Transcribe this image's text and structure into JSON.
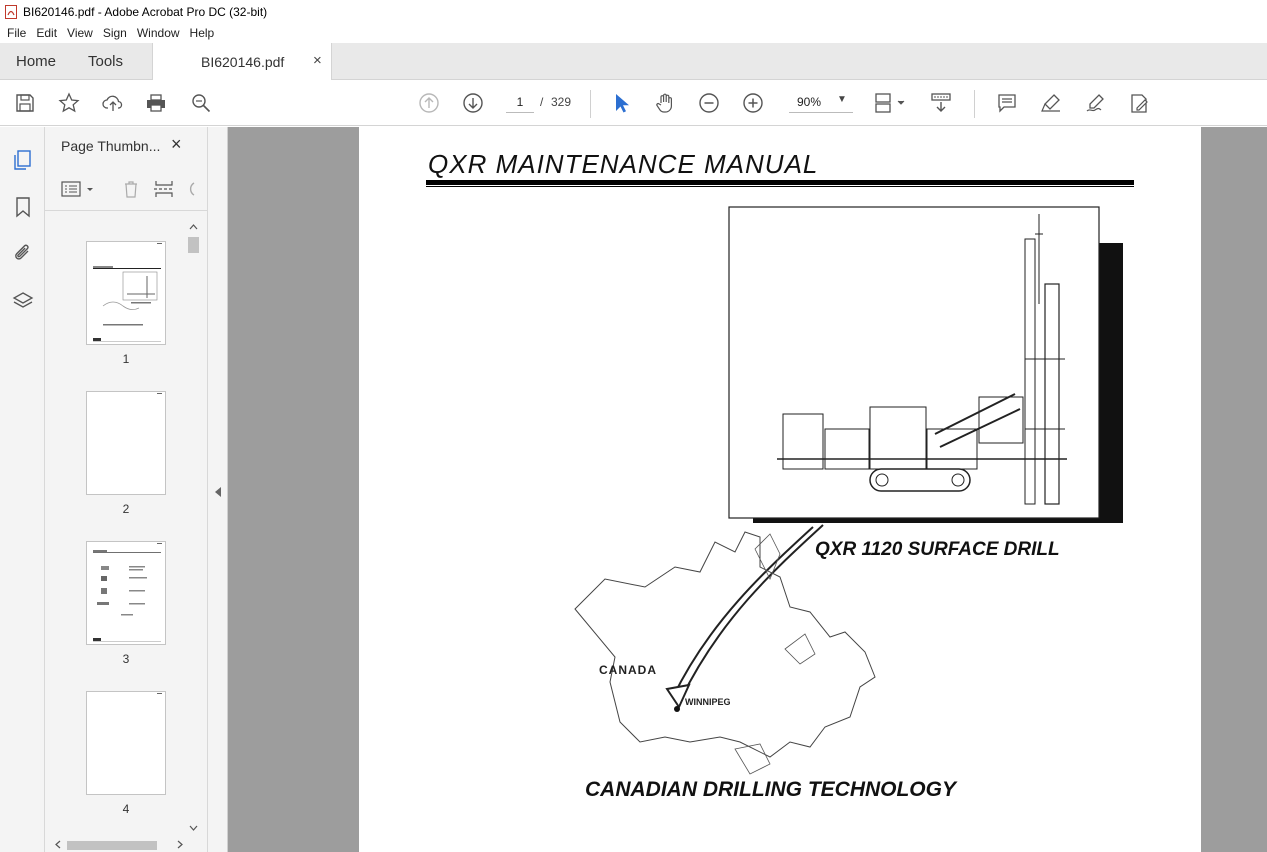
{
  "window": {
    "title": "BI620146.pdf - Adobe Acrobat Pro DC (32-bit)"
  },
  "menu": [
    "File",
    "Edit",
    "View",
    "Sign",
    "Window",
    "Help"
  ],
  "tabs": {
    "home": "Home",
    "tools": "Tools",
    "document": "BI620146.pdf",
    "close": "×"
  },
  "toolbar": {
    "current_page": "1",
    "page_separator": "/",
    "total_pages": "329",
    "zoom": "90%"
  },
  "panel": {
    "title": "Page Thumbn...",
    "close": "×",
    "thumbnails": [
      {
        "label": "1"
      },
      {
        "label": "2"
      },
      {
        "label": "3"
      },
      {
        "label": "4"
      }
    ]
  },
  "document": {
    "title": "QXR MAINTENANCE MANUAL",
    "drill_caption": "QXR 1120 SURFACE DRILL",
    "map_country": "CANADA",
    "map_city": "WINNIPEG",
    "company": "CANADIAN DRILLING TECHNOLOGY"
  },
  "colors": {
    "accent": "#2c6fd1",
    "viewer_bg": "#9d9d9d",
    "tab_bg": "#e9e9e9"
  }
}
